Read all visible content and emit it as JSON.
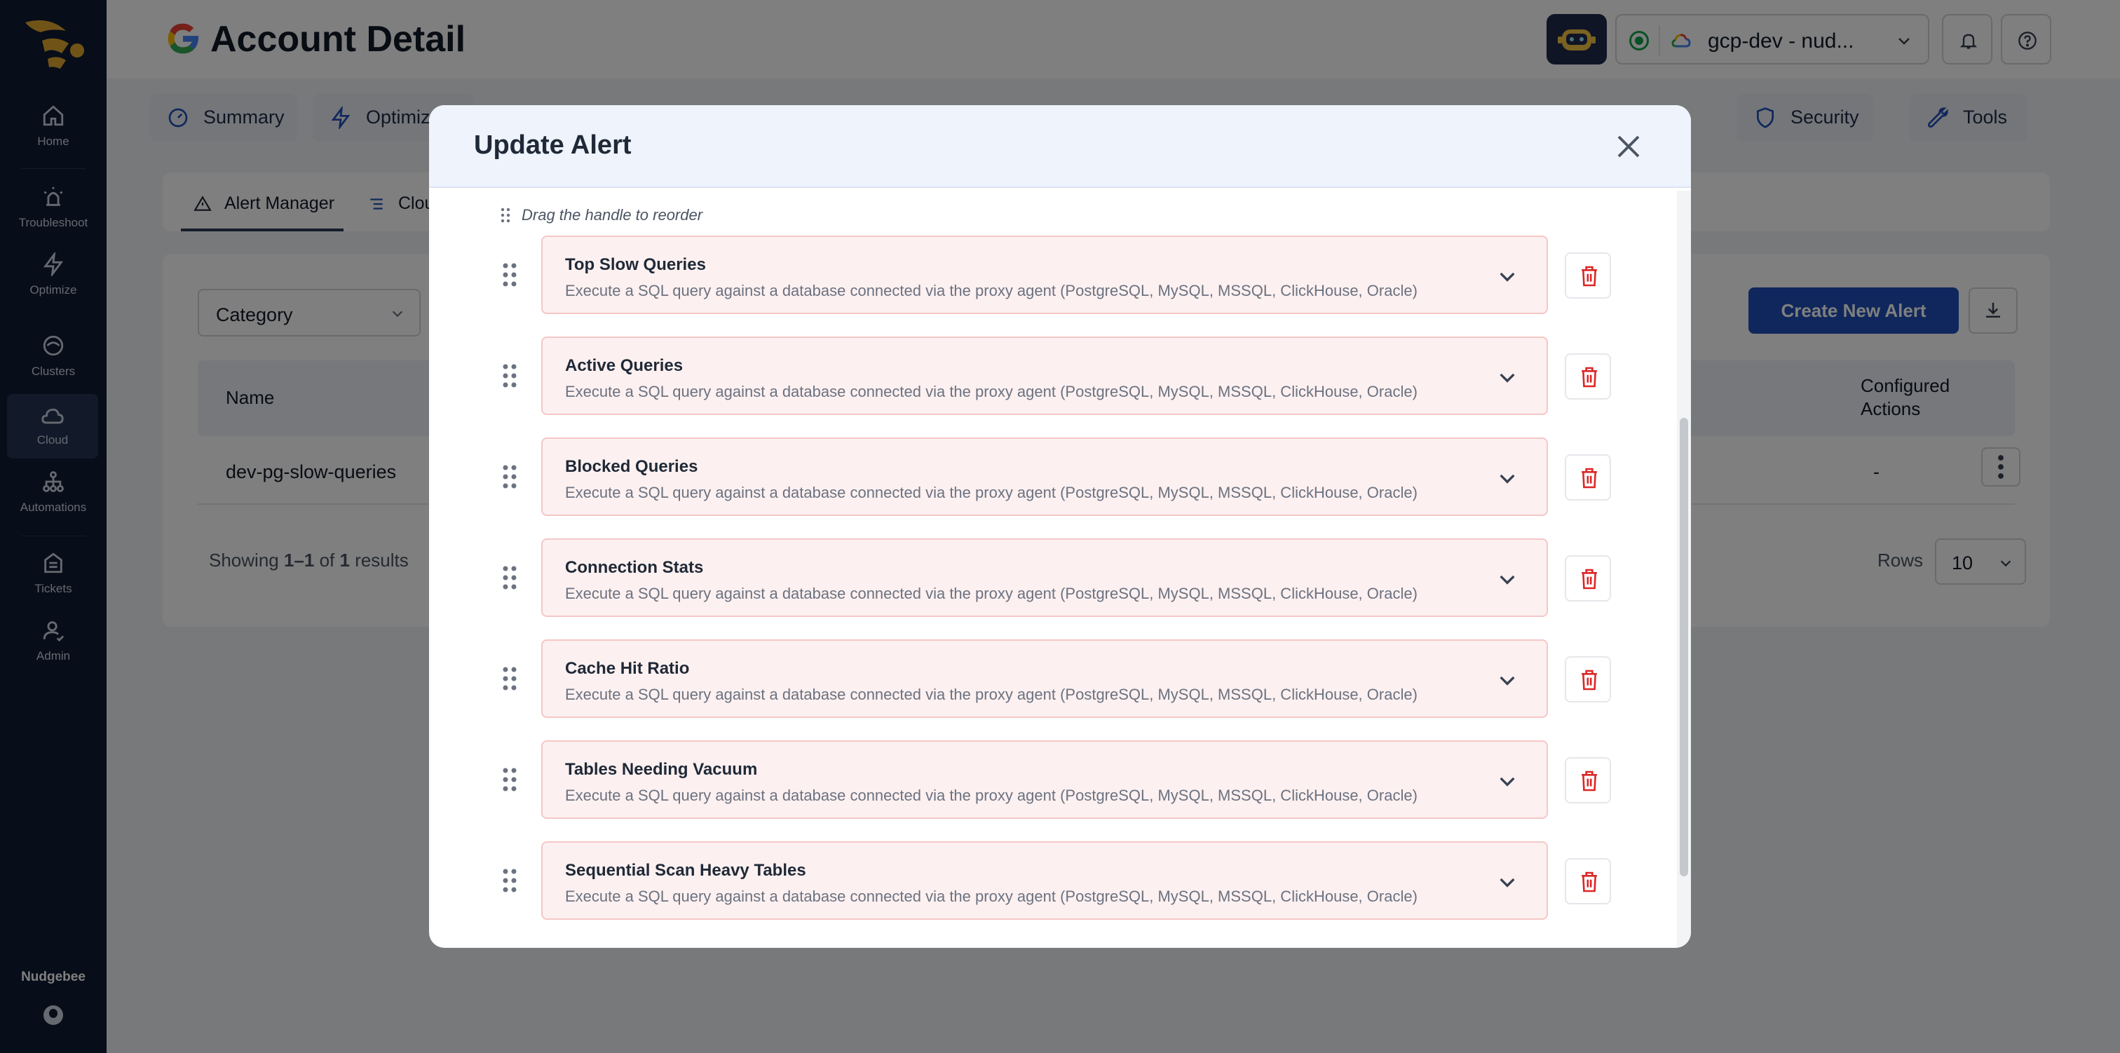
{
  "sidebar": {
    "items": [
      {
        "label": "Home",
        "icon": "home-icon"
      },
      {
        "label": "Troubleshoot",
        "icon": "troubleshoot-icon"
      },
      {
        "label": "Optimize",
        "icon": "bolt-icon"
      },
      {
        "label": "Clusters",
        "icon": "clusters-icon"
      },
      {
        "label": "Cloud",
        "icon": "cloud-icon",
        "active": true
      },
      {
        "label": "Automations",
        "icon": "automations-icon"
      },
      {
        "label": "Tickets",
        "icon": "tickets-icon"
      },
      {
        "label": "Admin",
        "icon": "admin-icon"
      }
    ],
    "brand": "Nudgebee"
  },
  "header": {
    "title": "Account Detail",
    "environment": "gcp-dev - nud..."
  },
  "tabs": [
    {
      "label": "Summary",
      "icon": "gauge-icon"
    },
    {
      "label": "Optimize",
      "icon": "bolt-icon"
    },
    {
      "label": "Security",
      "icon": "shield-icon"
    },
    {
      "label": "Tools",
      "icon": "wrench-icon"
    }
  ],
  "subtabs": [
    {
      "label": "Alert Manager",
      "icon": "alert-triangle-icon",
      "active": true
    },
    {
      "label": "Clou",
      "icon": "list-icon"
    }
  ],
  "filters": {
    "category_placeholder": "Category"
  },
  "actions": {
    "create_label": "Create New Alert"
  },
  "table": {
    "columns": [
      "Name",
      "Configured Actions"
    ],
    "rows": [
      {
        "name": "dev-pg-slow-queries",
        "configured_actions": "-"
      }
    ],
    "showing": {
      "prefix": "Showing ",
      "range": "1–1",
      "of": " of ",
      "total": "1",
      "suffix": " results"
    },
    "rows_label": "Rows",
    "rows_value": "10"
  },
  "modal": {
    "title": "Update Alert",
    "hint": "Drag the handle to reorder",
    "alerts": [
      {
        "title": "Top Slow Queries",
        "description": "Execute a SQL query against a database connected via the proxy agent (PostgreSQL, MySQL, MSSQL, ClickHouse, Oracle)"
      },
      {
        "title": "Active Queries",
        "description": "Execute a SQL query against a database connected via the proxy agent (PostgreSQL, MySQL, MSSQL, ClickHouse, Oracle)"
      },
      {
        "title": "Blocked Queries",
        "description": "Execute a SQL query against a database connected via the proxy agent (PostgreSQL, MySQL, MSSQL, ClickHouse, Oracle)"
      },
      {
        "title": "Connection Stats",
        "description": "Execute a SQL query against a database connected via the proxy agent (PostgreSQL, MySQL, MSSQL, ClickHouse, Oracle)"
      },
      {
        "title": "Cache Hit Ratio",
        "description": "Execute a SQL query against a database connected via the proxy agent (PostgreSQL, MySQL, MSSQL, ClickHouse, Oracle)"
      },
      {
        "title": "Tables Needing Vacuum",
        "description": "Execute a SQL query against a database connected via the proxy agent (PostgreSQL, MySQL, MSSQL, ClickHouse, Oracle)"
      },
      {
        "title": "Sequential Scan Heavy Tables",
        "description": "Execute a SQL query against a database connected via the proxy agent (PostgreSQL, MySQL, MSSQL, ClickHouse, Oracle)"
      }
    ]
  },
  "colors": {
    "sidebar_bg": "#0f1b33",
    "accent": "#1e4fb8",
    "alert_card_bg": "#fdf0f0",
    "alert_card_border": "#f5c7c7",
    "delete_red": "#dc2626"
  }
}
